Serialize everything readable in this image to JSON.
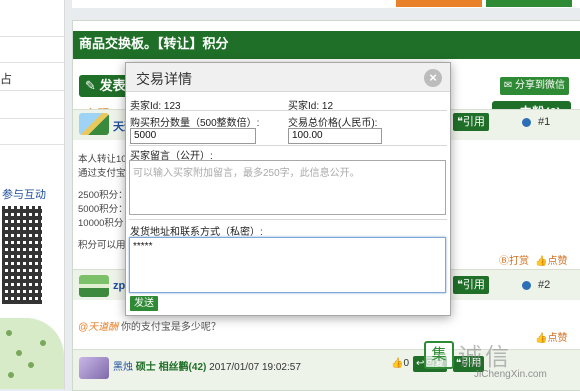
{
  "left_sidebar": {
    "cut_char": "占",
    "interact_text": "参与互动"
  },
  "panel": {
    "header_title": "商品交换板。【转让】积分",
    "post_button": "发表话题",
    "share_button": "分享到微信",
    "topic_label": "主题：",
    "fans_button": "一 去粉(6)"
  },
  "posts": [
    {
      "name_partial": "天道",
      "quote_label": "引用",
      "floor": "#1",
      "lines": [
        "本人转让100",
        "通过支付宝交",
        "",
        "2500积分：",
        "5000积分：",
        "10000积分：",
        "",
        "积分可以用于"
      ],
      "tip_label": "打赏",
      "like_label": "点赞"
    },
    {
      "name_partial": "zpy",
      "quote_label": "引用",
      "floor": "#2",
      "quote_who": "@天道酬",
      "quote_text": "你的支付宝是多少呢？",
      "like_label": "点赞"
    },
    {
      "nick": "黑烛",
      "rank_title": "硕士",
      "rank_info": "相丝鹳(42)",
      "timestamp": "2017/01/07 19:02:57",
      "like_count": "0",
      "reply_label": "回复",
      "quote_label": "引用"
    }
  ],
  "modal": {
    "title": "交易详情",
    "close_symbol": "×",
    "seller_id_label": "卖家Id: 123",
    "buyer_id_label": "买家Id: 12",
    "quantity_label": "购买积分数量（500整数倍）:",
    "quantity_value": "5000",
    "price_label": "交易总价格(人民币):",
    "price_value": "100.00",
    "message_label": "买家留言（公开）:",
    "message_placeholder": "可以输入买家附加留言，最多250字，此信息公开。",
    "address_label": "发货地址和联系方式（私密）:",
    "address_value": "*****",
    "send_button": "发送"
  },
  "watermark": {
    "logo_char": "集",
    "text": "诚信",
    "url": "JiChengXin.com"
  }
}
